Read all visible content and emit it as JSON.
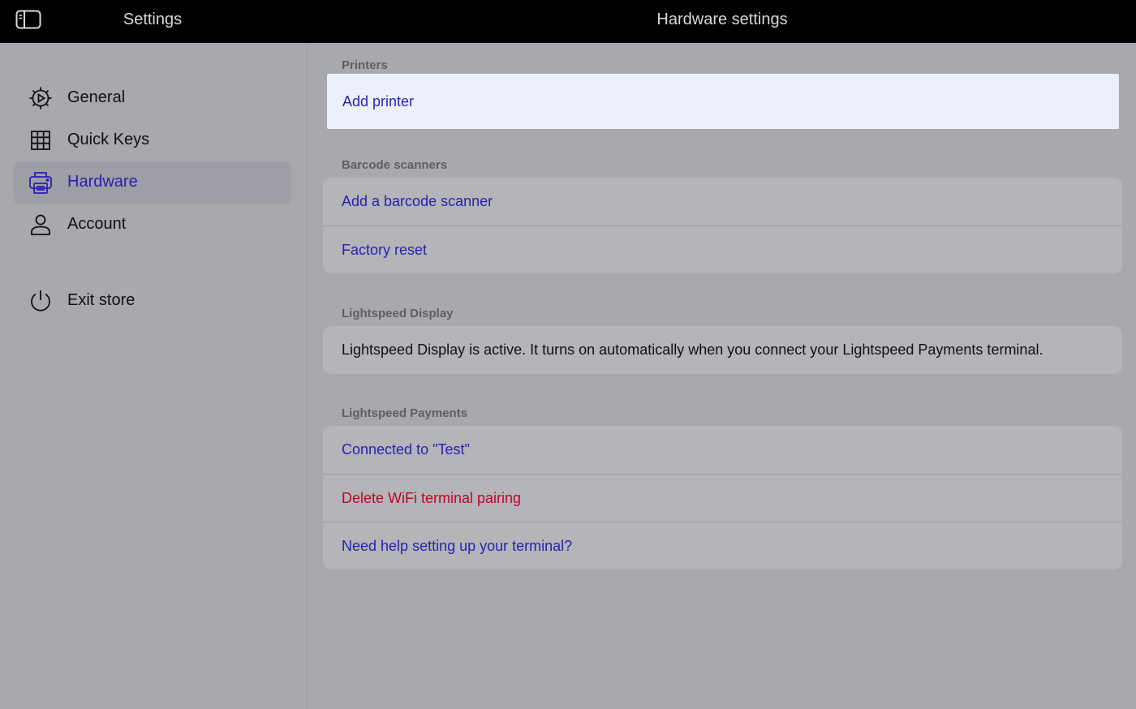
{
  "header": {
    "sidebar_title": "Settings",
    "page_title": "Hardware settings"
  },
  "sidebar": {
    "items": [
      {
        "label": "General",
        "icon": "gear-icon"
      },
      {
        "label": "Quick Keys",
        "icon": "grid-icon"
      },
      {
        "label": "Hardware",
        "icon": "printer-icon",
        "active": true
      },
      {
        "label": "Account",
        "icon": "user-icon"
      },
      {
        "label": "Exit store",
        "icon": "power-icon"
      }
    ]
  },
  "sections": {
    "printers": {
      "title": "Printers",
      "add_printer": "Add printer"
    },
    "barcode": {
      "title": "Barcode scanners",
      "add": "Add a barcode scanner",
      "reset": "Factory reset"
    },
    "display": {
      "title": "Lightspeed Display",
      "text": "Lightspeed Display is active. It turns on automatically when you connect your Lightspeed Payments terminal."
    },
    "payments": {
      "title": "Lightspeed Payments",
      "connected": "Connected to \"Test\"",
      "delete": "Delete WiFi terminal pairing",
      "help": "Need help setting up your terminal?"
    }
  },
  "colors": {
    "accent": "#2a1fb0",
    "danger": "#c0052a",
    "highlight": "#ecf0fd"
  }
}
